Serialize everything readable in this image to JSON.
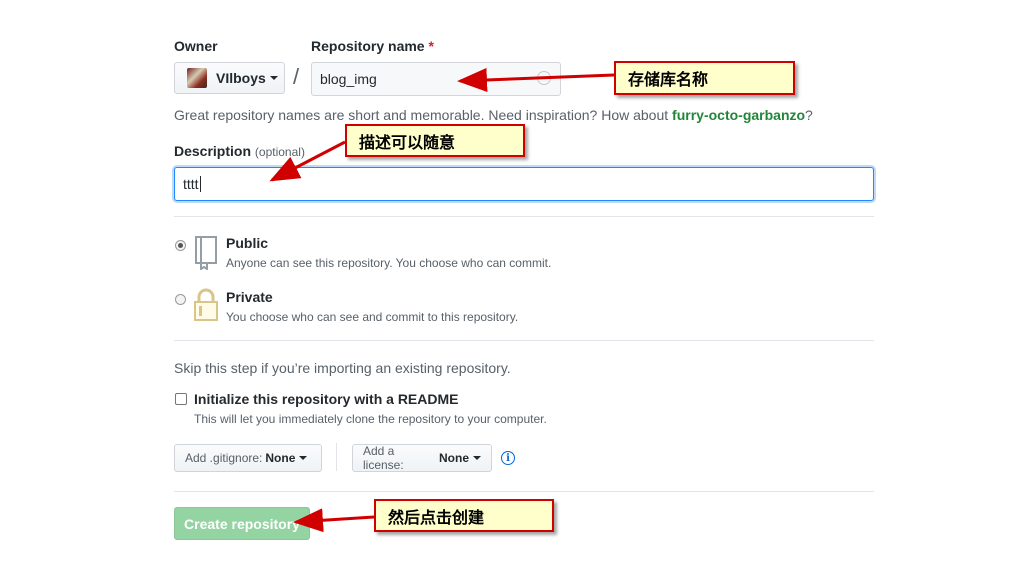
{
  "owner": {
    "label": "Owner",
    "value": "VIlboys"
  },
  "repo": {
    "label": "Repository name",
    "required_mark": "*",
    "value": "blog_img"
  },
  "hint": {
    "prefix": "Great repository names are short and memorable. Need inspiration? How about ",
    "suggestion": "furry-octo-garbanzo",
    "suffix": "?"
  },
  "description": {
    "label": "Description",
    "optional": "(optional)",
    "value": "tttt"
  },
  "visibility": {
    "public": {
      "title": "Public",
      "note": "Anyone can see this repository. You choose who can commit.",
      "selected": true
    },
    "private": {
      "title": "Private",
      "note": "You choose who can see and commit to this repository.",
      "selected": false
    }
  },
  "import_note": "Skip this step if you’re importing an existing repository.",
  "readme": {
    "title": "Initialize this repository with a README",
    "note": "This will let you immediately clone the repository to your computer.",
    "checked": false
  },
  "gitignore": {
    "label": "Add .gitignore:",
    "value": "None"
  },
  "license": {
    "label": "Add a license:",
    "value": "None"
  },
  "create_button": "Create repository",
  "annotations": {
    "repo_name": "存储库名称",
    "description": "描述可以随意",
    "create": "然后点击创建"
  },
  "colors": {
    "annotation_border": "#d00000",
    "annotation_fill": "#ffffcc",
    "create_button": "#94d3a2",
    "suggestion": "#22863a"
  }
}
